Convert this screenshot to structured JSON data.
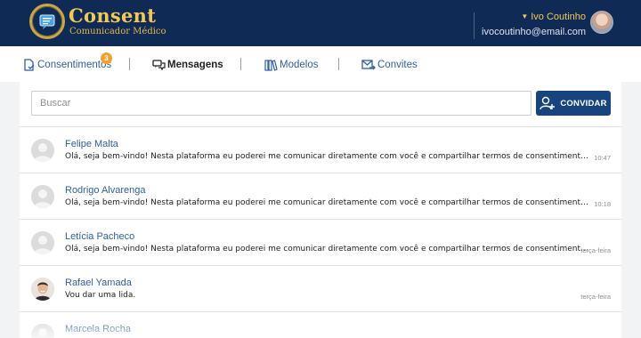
{
  "app": {
    "brand": "Consent",
    "brand_subtitle": "Comunicador Médico"
  },
  "user": {
    "name": "Ivo Coutinho",
    "email": "ivocoutinho@email.com"
  },
  "nav": {
    "items": [
      {
        "label": "Consentimentos",
        "icon": "document-icon",
        "badge": "3"
      },
      {
        "label": "Mensagens",
        "icon": "chat-icon",
        "active": true
      },
      {
        "label": "Modelos",
        "icon": "books-icon"
      },
      {
        "label": "Convites",
        "icon": "mail-arrow-icon"
      }
    ]
  },
  "search": {
    "placeholder": "Buscar",
    "value": ""
  },
  "invite_button": {
    "label": "CONVIDAR",
    "icon": "add-user-icon"
  },
  "messages": [
    {
      "name": "Felipe Malta",
      "preview": "Olá, seja bem-vindo! Nesta plataforma eu poderei me comunicar diretamente com você e compartilhar termos de consentimento para você ler e assinar.",
      "time": "10:47",
      "avatar": "placeholder"
    },
    {
      "name": "Rodrigo Alvarenga",
      "preview": "Olá, seja bem-vindo! Nesta plataforma eu poderei me comunicar diretamente com você e compartilhar termos de consentimento para você ler e assinar.",
      "time": "10:18",
      "avatar": "placeholder"
    },
    {
      "name": "Letícia Pacheco",
      "preview": "Olá, seja bem-vindo! Nesta plataforma eu poderei me comunicar diretamente com você e compartilhar termos de consentimento para você ler e assinar.",
      "time": "terça-feira",
      "avatar": "placeholder"
    },
    {
      "name": "Rafael Yamada",
      "preview": "Vou dar uma lida.",
      "time": "terça-feira",
      "avatar": "photo"
    },
    {
      "name": "Marcela Rocha",
      "preview": "",
      "time": "",
      "avatar": "placeholder"
    }
  ],
  "colors": {
    "header_bg": "#0f2a55",
    "brand_gold": "#f2c955",
    "link_blue": "#2f5fa0",
    "button_blue": "#17447f",
    "badge_orange": "#f0a22c"
  }
}
